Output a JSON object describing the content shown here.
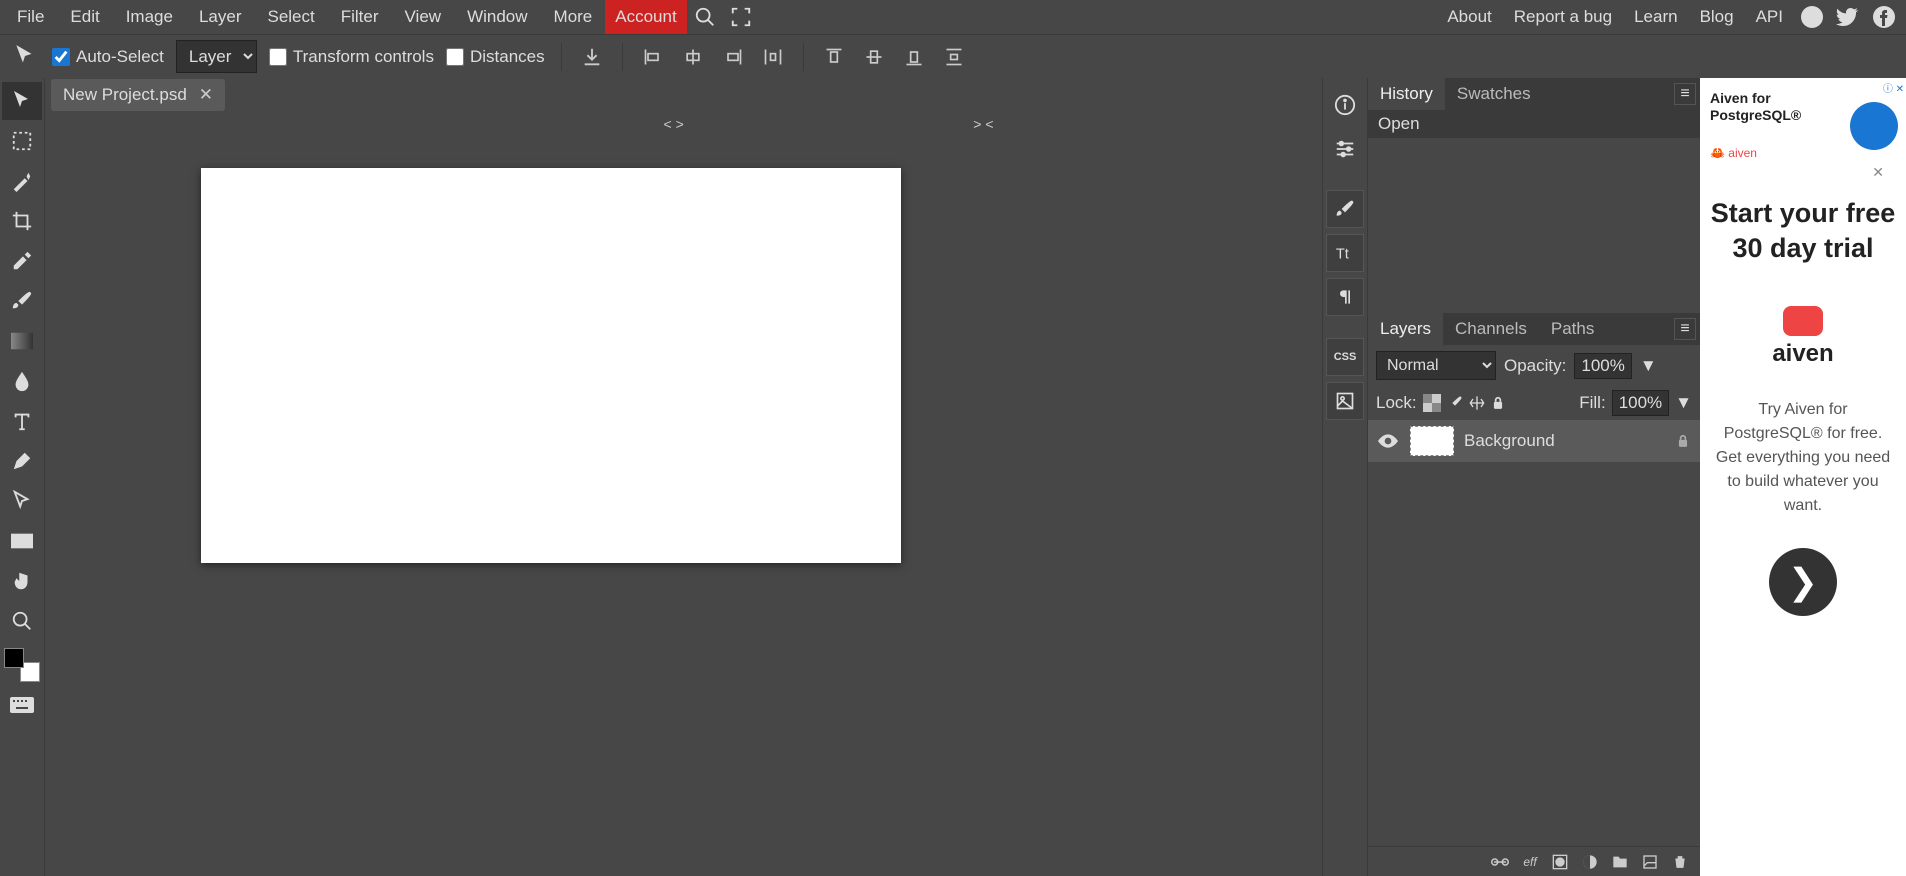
{
  "menubar": {
    "items": [
      "File",
      "Edit",
      "Image",
      "Layer",
      "Select",
      "Filter",
      "View",
      "Window",
      "More"
    ],
    "account": "Account",
    "right": [
      "About",
      "Report a bug",
      "Learn",
      "Blog",
      "API"
    ]
  },
  "options": {
    "auto_select": "Auto-Select",
    "scope_options": [
      "Layer"
    ],
    "scope": "Layer",
    "transform": "Transform controls",
    "distances": "Distances"
  },
  "document": {
    "tab_name": "New Project.psd"
  },
  "history_panel": {
    "tabs": [
      "History",
      "Swatches"
    ],
    "active": 0,
    "items": [
      "Open"
    ]
  },
  "layers_panel": {
    "tabs": [
      "Layers",
      "Channels",
      "Paths"
    ],
    "active": 0,
    "blend_modes": [
      "Normal"
    ],
    "blend": "Normal",
    "opacity_label": "Opacity:",
    "opacity": "100%",
    "lock_label": "Lock:",
    "fill_label": "Fill:",
    "fill": "100%",
    "layers": [
      {
        "name": "Background",
        "locked": true
      }
    ],
    "footer_icons": [
      "link",
      "fx",
      "mask",
      "adjust",
      "folder",
      "new",
      "trash"
    ]
  },
  "ad": {
    "head1": "Aiven for",
    "head2": "PostgreSQL®",
    "tag": "aiven",
    "title": "Start your free 30 day trial",
    "brand": "aiven",
    "body": "Try Aiven for PostgreSQL® for free. Get everything you need to build whatever you want."
  },
  "canvas_nav": {
    "left": "< >",
    "right": "> <"
  }
}
